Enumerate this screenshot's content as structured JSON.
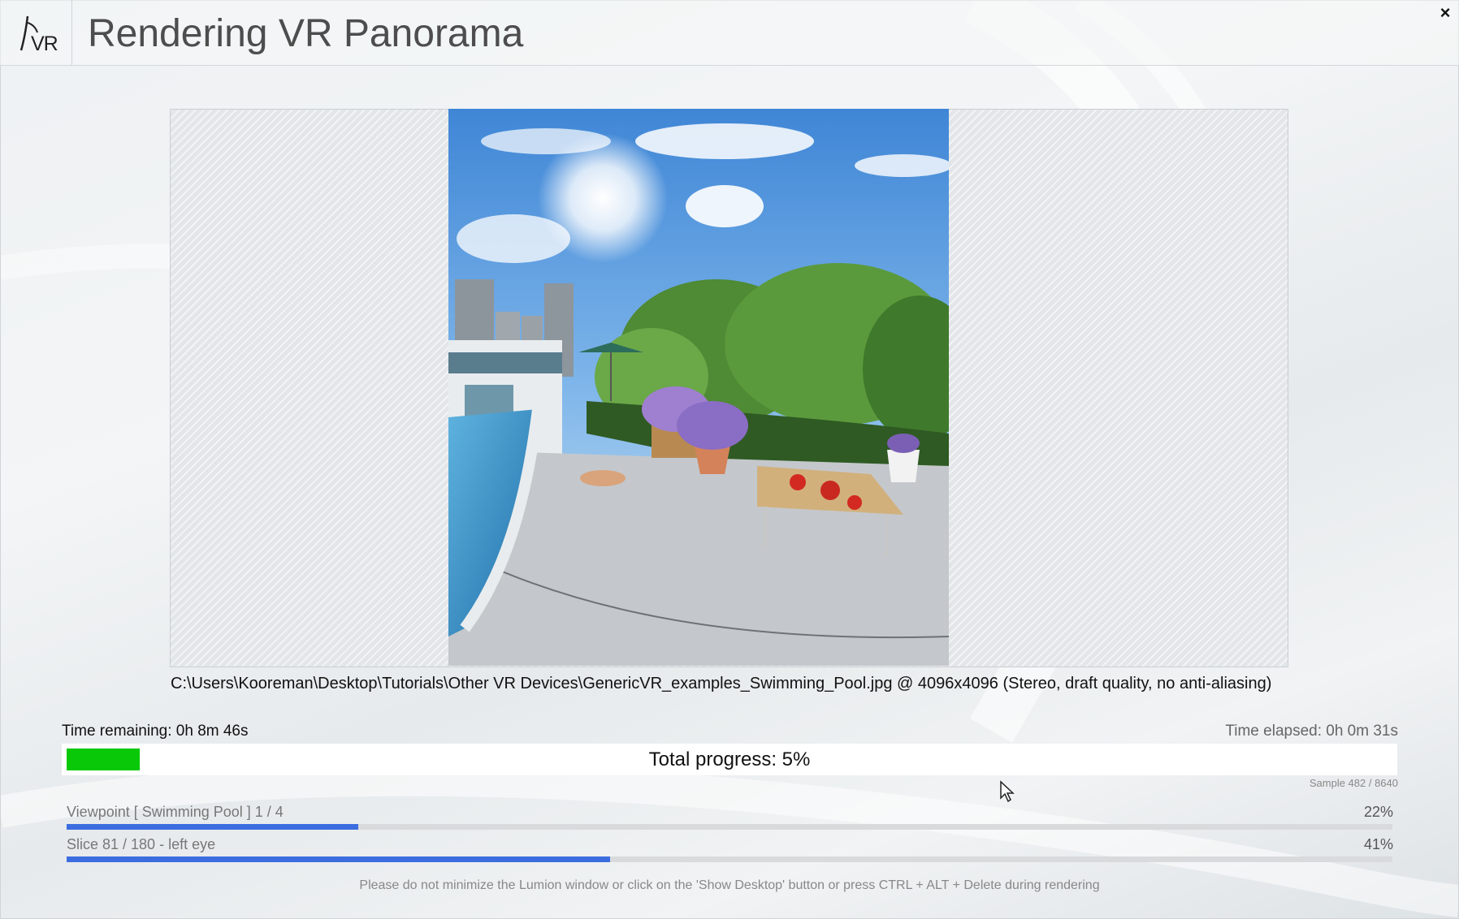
{
  "window": {
    "logo_text": "VR",
    "title": "Rendering VR Panorama",
    "close_symbol": "×"
  },
  "preview": {
    "file_info": "C:\\Users\\Kooreman\\Desktop\\Tutorials\\Other VR Devices\\GenericVR_examples_Swimming_Pool.jpg @ 4096x4096 (Stereo, draft quality, no anti-aliasing)"
  },
  "progress": {
    "time_remaining": "Time remaining: 0h 8m 46s",
    "time_elapsed": "Time elapsed: 0h 0m 31s",
    "total_label": "Total progress: 5%",
    "total_fraction": 0.05,
    "fill_color": "#08c808",
    "sample": "Sample 482 / 8640",
    "viewpoint_label": "Viewpoint [ Swimming Pool ] 1 / 4",
    "viewpoint_pct": "22%",
    "viewpoint_fraction": 0.22,
    "slice_label": "Slice 81 / 180 - left eye",
    "slice_pct": "41%",
    "slice_fraction": 0.41,
    "bar_color": "#3c6de0"
  },
  "footer": {
    "notice": "Please do not minimize the Lumion window or click on the 'Show Desktop' button or press CTRL + ALT + Delete during rendering"
  }
}
